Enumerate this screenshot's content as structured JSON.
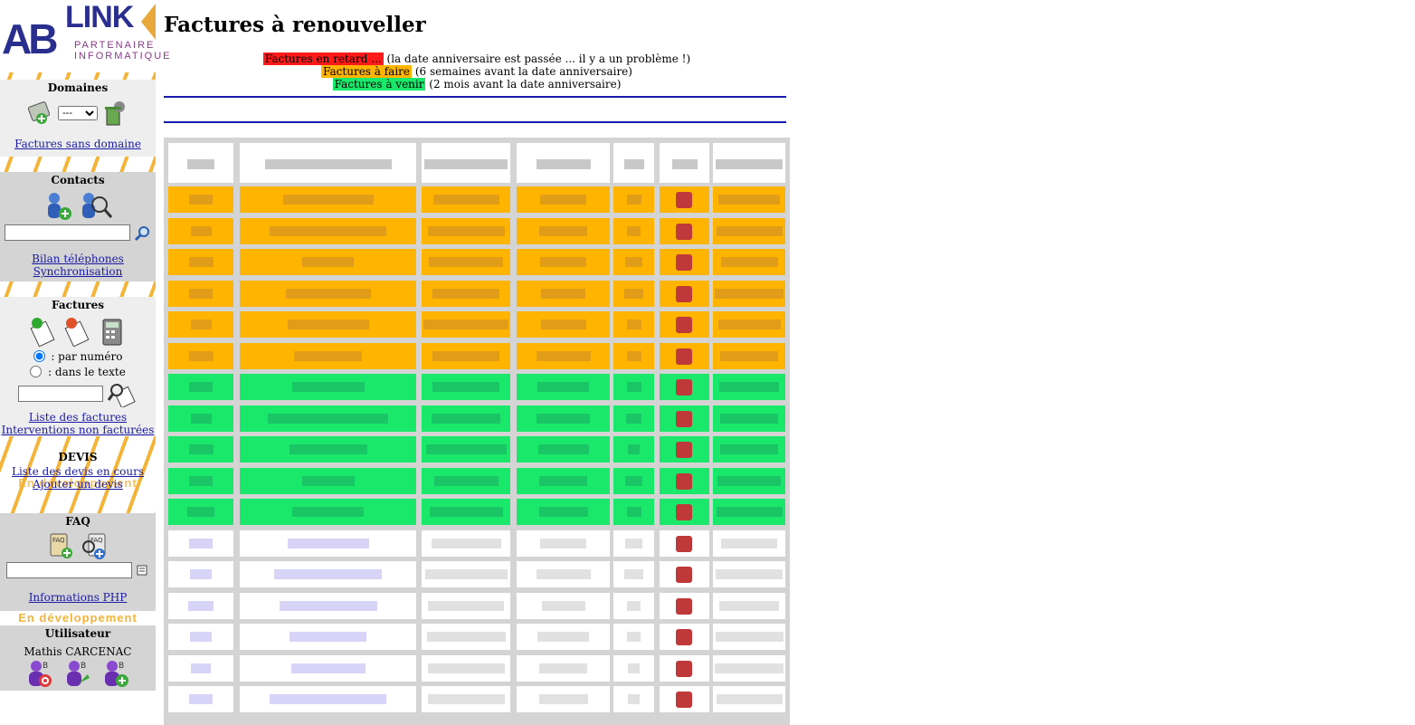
{
  "sidebar": {
    "domains": {
      "title": "Domaines",
      "select_value": "---",
      "link": "Factures sans domaine"
    },
    "contacts": {
      "title": "Contacts",
      "search_value": "",
      "links": [
        "Bilan téléphones",
        "Synchronisation"
      ]
    },
    "invoices": {
      "title": "Factures",
      "radio_number": ": par numéro",
      "radio_text": ": dans le texte",
      "search_value": "",
      "links": [
        "Liste des factures",
        "Interventions non facturées"
      ]
    },
    "quotes": {
      "title": "DEVIS",
      "links": [
        "Liste des devis en cours",
        "Ajouter un devis"
      ]
    },
    "faq": {
      "title": "FAQ",
      "search_value": "",
      "link": "Informations PHP"
    },
    "dev_banner": "En développement",
    "user": {
      "title": "Utilisateur",
      "name": "Mathis CARCENAC"
    }
  },
  "logo": {
    "a": "AB",
    "link": "LINK",
    "sub1": "PARTENAIRE",
    "sub2": "INFORMATIQUE"
  },
  "main": {
    "title": "Factures à renouveller",
    "legend": [
      {
        "tag": "Factures en retard ...",
        "text": " (la date anniversaire est passée ... il y a un problème !)",
        "color": "#ff1a1a"
      },
      {
        "tag": "Factures à faire",
        "text": " (6 semaines avant la date anniversaire)",
        "color": "#ffb400"
      },
      {
        "tag": "Factures à venir",
        "text": " (2 mois avant la date anniversaire)",
        "color": "#19e86a"
      }
    ]
  },
  "table": {
    "row_groups": [
      {
        "status": "à faire",
        "color": "#ffb400",
        "count": 6
      },
      {
        "status": "à venir",
        "color": "#19e86a",
        "count": 5
      },
      {
        "status": "normal",
        "color": "#ffffff",
        "count": 6
      }
    ]
  },
  "colors": {
    "accent_rule": "#1a1ab0",
    "panel_gray": "#d4d4d4",
    "link": "#1a1aa6"
  }
}
